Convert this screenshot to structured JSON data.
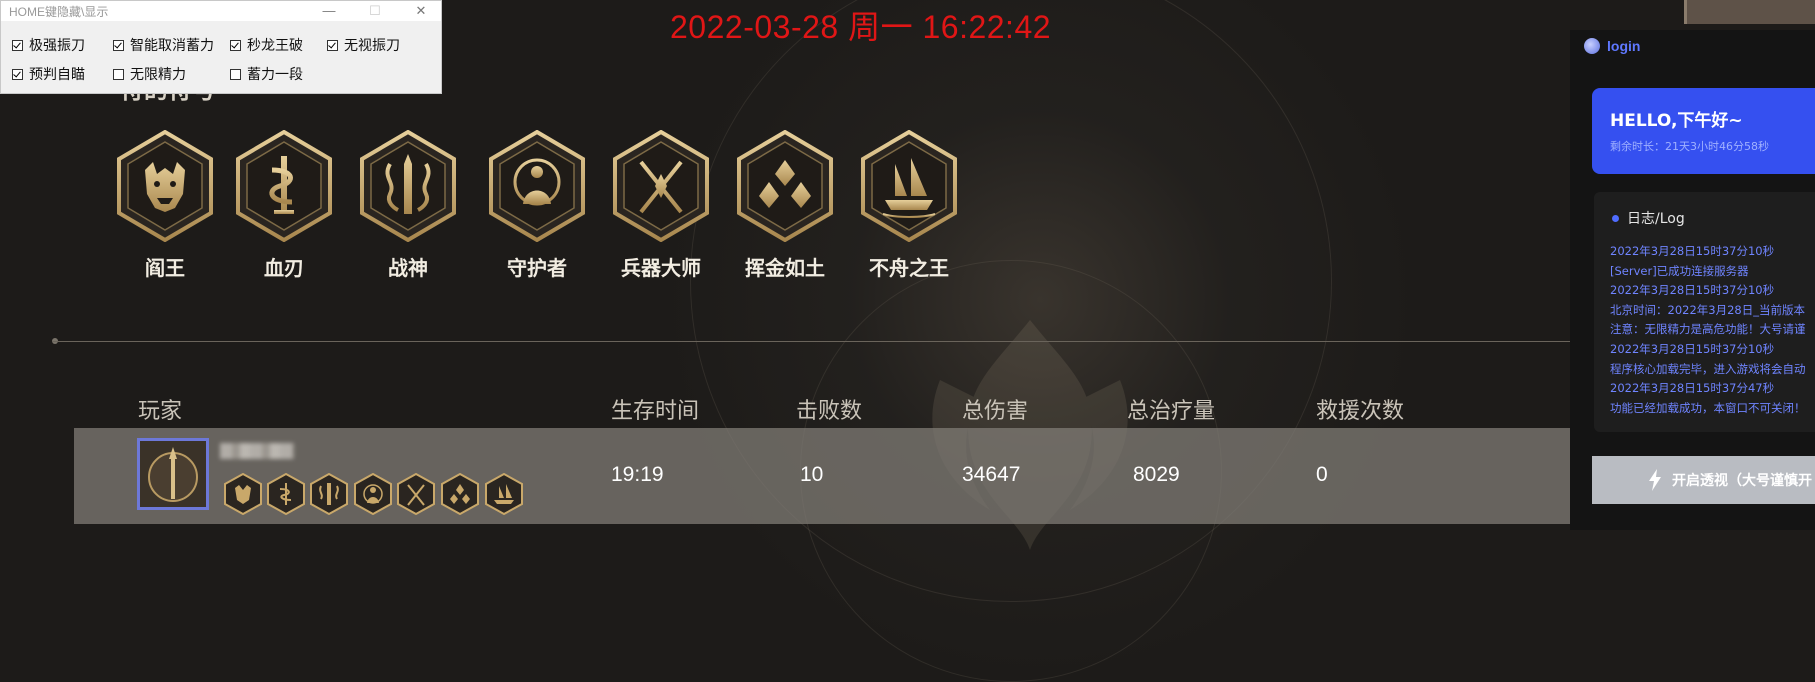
{
  "clock": {
    "datetime": "2022-03-28 周一 16:22:42"
  },
  "overlay": {
    "title": "HOME键隐藏\\显示",
    "options": [
      {
        "label": "极强振刀",
        "checked": true
      },
      {
        "label": "智能取消蓄力",
        "checked": true
      },
      {
        "label": "秒龙王破",
        "checked": true
      },
      {
        "label": "无视振刀",
        "checked": true
      },
      {
        "label": "预判自瞄",
        "checked": true
      },
      {
        "label": "无限精力",
        "checked": false
      },
      {
        "label": "蓄力一段",
        "checked": false
      }
    ]
  },
  "section_title": "符的符号",
  "heroes": [
    {
      "name": "阎王",
      "icon": "oni-mask-icon"
    },
    {
      "name": "血刃",
      "icon": "serpent-sword-icon"
    },
    {
      "name": "战神",
      "icon": "twin-blades-icon"
    },
    {
      "name": "守护者",
      "icon": "guardian-monk-icon"
    },
    {
      "name": "兵器大师",
      "icon": "crossed-weapons-icon"
    },
    {
      "name": "挥金如土",
      "icon": "gold-coins-icon"
    },
    {
      "name": "不舟之王",
      "icon": "ship-icon"
    }
  ],
  "table": {
    "headers": [
      "玩家",
      "生存时间",
      "击败数",
      "总伤害",
      "总治疗量",
      "救援次数"
    ],
    "row": {
      "survival_time": "19:19",
      "kills": "10",
      "damage": "34647",
      "healing": "8029",
      "rescues": "0"
    }
  },
  "panel": {
    "login_label": "login",
    "hello_title": "HELLO,下午好~",
    "hello_sub": "剩余时长：21天3小时46分58秒",
    "log_title": "日志/Log",
    "log_lines": [
      "2022年3月28日15时37分10秒",
      "[Server]已成功连接服务器",
      "2022年3月28日15时37分10秒",
      "北京时间：2022年3月28日_当前版本",
      "注意：无限精力是高危功能！大号请谨",
      "2022年3月28日15时37分10秒",
      "程序核心加载完毕，进入游戏将会自动",
      "2022年3月28日15时37分47秒",
      "功能已经加载成功，本窗口不可关闭！"
    ],
    "xray_button": "开启透视（大号谨慎开"
  },
  "colors": {
    "clock": "#e01616",
    "accent": "#3550f0",
    "gold": "#c9a86a"
  }
}
